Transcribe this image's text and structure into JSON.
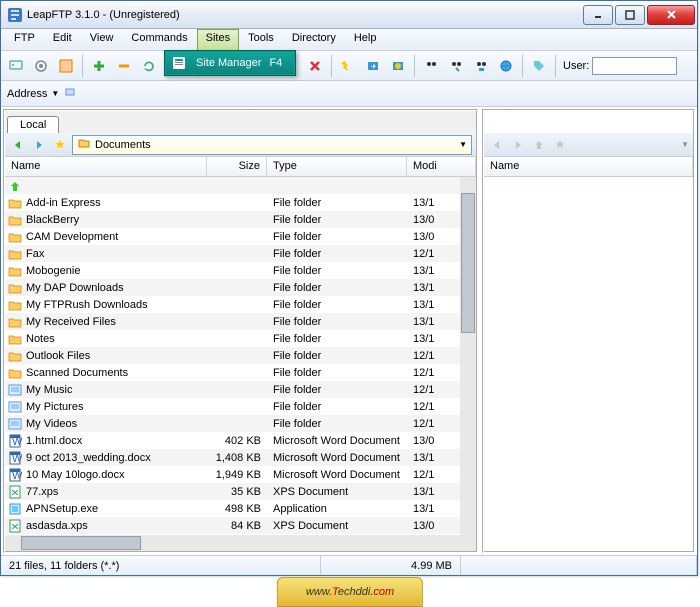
{
  "window": {
    "title": "LeapFTP 3.1.0 - (Unregistered)"
  },
  "menu": {
    "items": [
      "FTP",
      "Edit",
      "View",
      "Commands",
      "Sites",
      "Tools",
      "Directory",
      "Help"
    ],
    "open_index": 4
  },
  "sites_menu": {
    "label": "Site Manager",
    "shortcut": "F4"
  },
  "toolbar": {
    "user_label": "User:"
  },
  "addressbar": {
    "label": "Address"
  },
  "local": {
    "tab": "Local",
    "path": "Documents",
    "columns": [
      "Name",
      "Size",
      "Type",
      "Modi"
    ],
    "rows": [
      {
        "icon": "up",
        "name": "<Parent directory>",
        "size": "",
        "type": "",
        "modi": ""
      },
      {
        "icon": "folder",
        "name": "Add-in Express",
        "size": "",
        "type": "File folder",
        "modi": "13/1"
      },
      {
        "icon": "folder",
        "name": "BlackBerry",
        "size": "",
        "type": "File folder",
        "modi": "13/0"
      },
      {
        "icon": "folder",
        "name": "CAM Development",
        "size": "",
        "type": "File folder",
        "modi": "13/0"
      },
      {
        "icon": "folder",
        "name": "Fax",
        "size": "",
        "type": "File folder",
        "modi": "12/1"
      },
      {
        "icon": "folder",
        "name": "Mobogenie",
        "size": "",
        "type": "File folder",
        "modi": "13/1"
      },
      {
        "icon": "folder",
        "name": "My DAP Downloads",
        "size": "",
        "type": "File folder",
        "modi": "13/1"
      },
      {
        "icon": "folder",
        "name": "My FTPRush Downloads",
        "size": "",
        "type": "File folder",
        "modi": "13/1"
      },
      {
        "icon": "folder",
        "name": "My Received Files",
        "size": "",
        "type": "File folder",
        "modi": "13/1"
      },
      {
        "icon": "folder",
        "name": "Notes",
        "size": "",
        "type": "File folder",
        "modi": "13/1"
      },
      {
        "icon": "folder",
        "name": "Outlook Files",
        "size": "",
        "type": "File folder",
        "modi": "12/1"
      },
      {
        "icon": "folder",
        "name": "Scanned Documents",
        "size": "",
        "type": "File folder",
        "modi": "12/1"
      },
      {
        "icon": "sys",
        "name": "My Music",
        "size": "",
        "type": "File folder",
        "modi": "12/1"
      },
      {
        "icon": "sys",
        "name": "My Pictures",
        "size": "",
        "type": "File folder",
        "modi": "12/1"
      },
      {
        "icon": "sys",
        "name": "My Videos",
        "size": "",
        "type": "File folder",
        "modi": "12/1"
      },
      {
        "icon": "docx",
        "name": "1.html.docx",
        "size": "402 KB",
        "type": "Microsoft Word Document",
        "modi": "13/0"
      },
      {
        "icon": "docx",
        "name": "9 oct 2013_wedding.docx",
        "size": "1,408 KB",
        "type": "Microsoft Word Document",
        "modi": "13/1"
      },
      {
        "icon": "docx",
        "name": "10 May 10logo.docx",
        "size": "1,949 KB",
        "type": "Microsoft Word Document",
        "modi": "12/1"
      },
      {
        "icon": "xps",
        "name": "77.xps",
        "size": "35 KB",
        "type": "XPS Document",
        "modi": "13/1"
      },
      {
        "icon": "exe",
        "name": "APNSetup.exe",
        "size": "498 KB",
        "type": "Application",
        "modi": "13/1"
      },
      {
        "icon": "xps",
        "name": "asdasda.xps",
        "size": "84 KB",
        "type": "XPS Document",
        "modi": "13/0"
      }
    ]
  },
  "remote": {
    "columns": [
      "Name"
    ]
  },
  "status": {
    "files": "21 files, 11 folders (*.*)",
    "size": "4.99 MB"
  },
  "watermark": {
    "a": "www.",
    "b": "T",
    "c": "echddi",
    "d": ".com"
  }
}
